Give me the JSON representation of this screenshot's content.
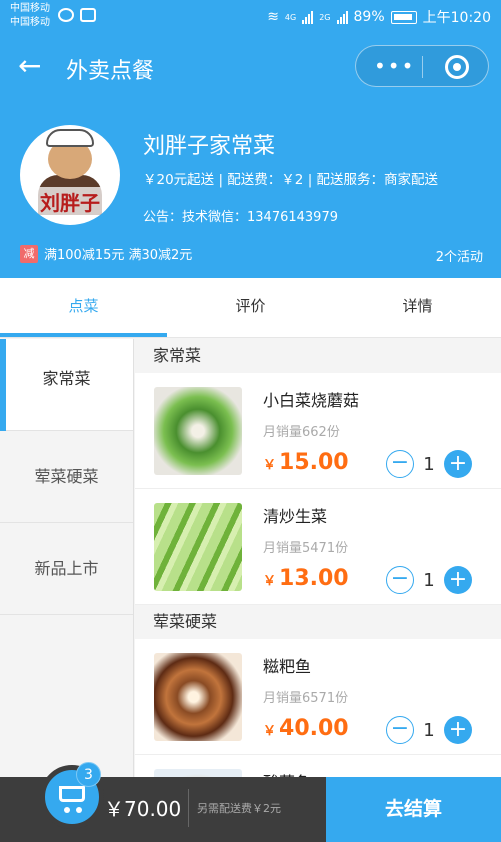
{
  "status_bar": {
    "carrier1": "中国移动",
    "carrier2": "中国移动",
    "network1": "4G",
    "network2": "2G",
    "battery": "89%",
    "time": "上午10:20"
  },
  "nav": {
    "title": "外卖点餐",
    "back_icon": "arrow-left-icon",
    "more_icon": "more-dots-icon",
    "close_icon": "target-icon"
  },
  "shop": {
    "logo_text": "刘胖子",
    "name": "刘胖子家常菜",
    "info": "￥20元起送 | 配送费：￥2 | 配送服务：商家配送",
    "notice": "公告：技术微信：13476143979",
    "promo_tag": "减",
    "promo_text": "满100减15元 满30减2元",
    "activity_count": "2个活动"
  },
  "tabs": [
    {
      "label": "点菜",
      "active": true
    },
    {
      "label": "评价",
      "active": false
    },
    {
      "label": "详情",
      "active": false
    }
  ],
  "categories": [
    {
      "label": "家常菜",
      "active": true
    },
    {
      "label": "荤菜硬菜",
      "active": false
    },
    {
      "label": "新品上市",
      "active": false
    }
  ],
  "sections": [
    {
      "title": "家常菜",
      "dishes": [
        {
          "name": "小白菜烧蘑菇",
          "sales": "月销量662份",
          "currency": "￥",
          "price": "15.00",
          "qty": "1"
        },
        {
          "name": "清炒生菜",
          "sales": "月销量5471份",
          "currency": "￥",
          "price": "13.00",
          "qty": "1"
        }
      ]
    },
    {
      "title": "荤菜硬菜",
      "dishes": [
        {
          "name": "糍粑鱼",
          "sales": "月销量6571份",
          "currency": "￥",
          "price": "40.00",
          "qty": "1"
        },
        {
          "name": "酸菜鱼",
          "sales": "",
          "currency": "",
          "price": "",
          "qty": ""
        }
      ]
    }
  ],
  "cart": {
    "badge": "3",
    "total": "￥70.00",
    "delivery_note": "另需配送费￥2元",
    "checkout_label": "去结算"
  },
  "colors": {
    "primary": "#35a9ef",
    "price": "#ff6d12",
    "cart_bg": "#3d3d3d"
  }
}
